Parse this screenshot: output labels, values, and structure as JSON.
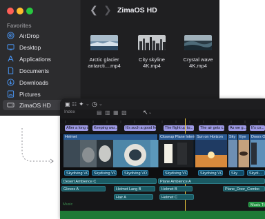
{
  "finder": {
    "title": "ZimaOS HD",
    "sidebar_title": "Favorites",
    "sidebar_items": [
      {
        "label": "AirDrop",
        "icon": "airdrop-icon"
      },
      {
        "label": "Desktop",
        "icon": "desktop-icon"
      },
      {
        "label": "Applications",
        "icon": "applications-icon"
      },
      {
        "label": "Documents",
        "icon": "documents-icon"
      },
      {
        "label": "Downloads",
        "icon": "downloads-icon"
      },
      {
        "label": "Pictures",
        "icon": "pictures-icon"
      },
      {
        "label": "ZimaOS HD",
        "icon": "drive-icon"
      }
    ],
    "selected_item": "ZimaOS HD",
    "files": [
      {
        "line1": "Arctic glacier",
        "line2": "antarcti....mp4"
      },
      {
        "line1": "City skyline",
        "line2": "4K.mp4"
      },
      {
        "line1": "Crystal wave",
        "line2": "4K.mp4"
      }
    ]
  },
  "fcp": {
    "toolbar_icons": [
      "browser-icon",
      "layout-icon",
      "magic-wand-icon",
      "speed-icon",
      "retime-icon",
      "select-tool-icon"
    ],
    "index_label": "Index",
    "title_clips": [
      "After a long d...",
      "Keeping war...",
      "It's such a good fe...",
      "The flight up to...",
      "The air gets c...",
      "As we g...",
      "It's co..."
    ],
    "video_labels": [
      "Helmet",
      "Closeup Plane Interior",
      "Sun on Horizon",
      "Sky",
      "Eye",
      "Doors Op..."
    ],
    "vo_clips": [
      "Skydiving VO",
      "Skydiving VO",
      "Skydiving VO",
      "Skydiving VO",
      "Skydiving VO",
      "Sky",
      "Skydi..."
    ],
    "audio_clips": [
      "Desert Ambience C",
      "Plane Ambience A",
      "Gloves A",
      "Helmet Lang B",
      "Helmet B",
      "Plane_Door_Combo",
      "Hair A",
      "Helmet C"
    ],
    "music_label": "Music",
    "music_track": "Music Tra..."
  }
}
